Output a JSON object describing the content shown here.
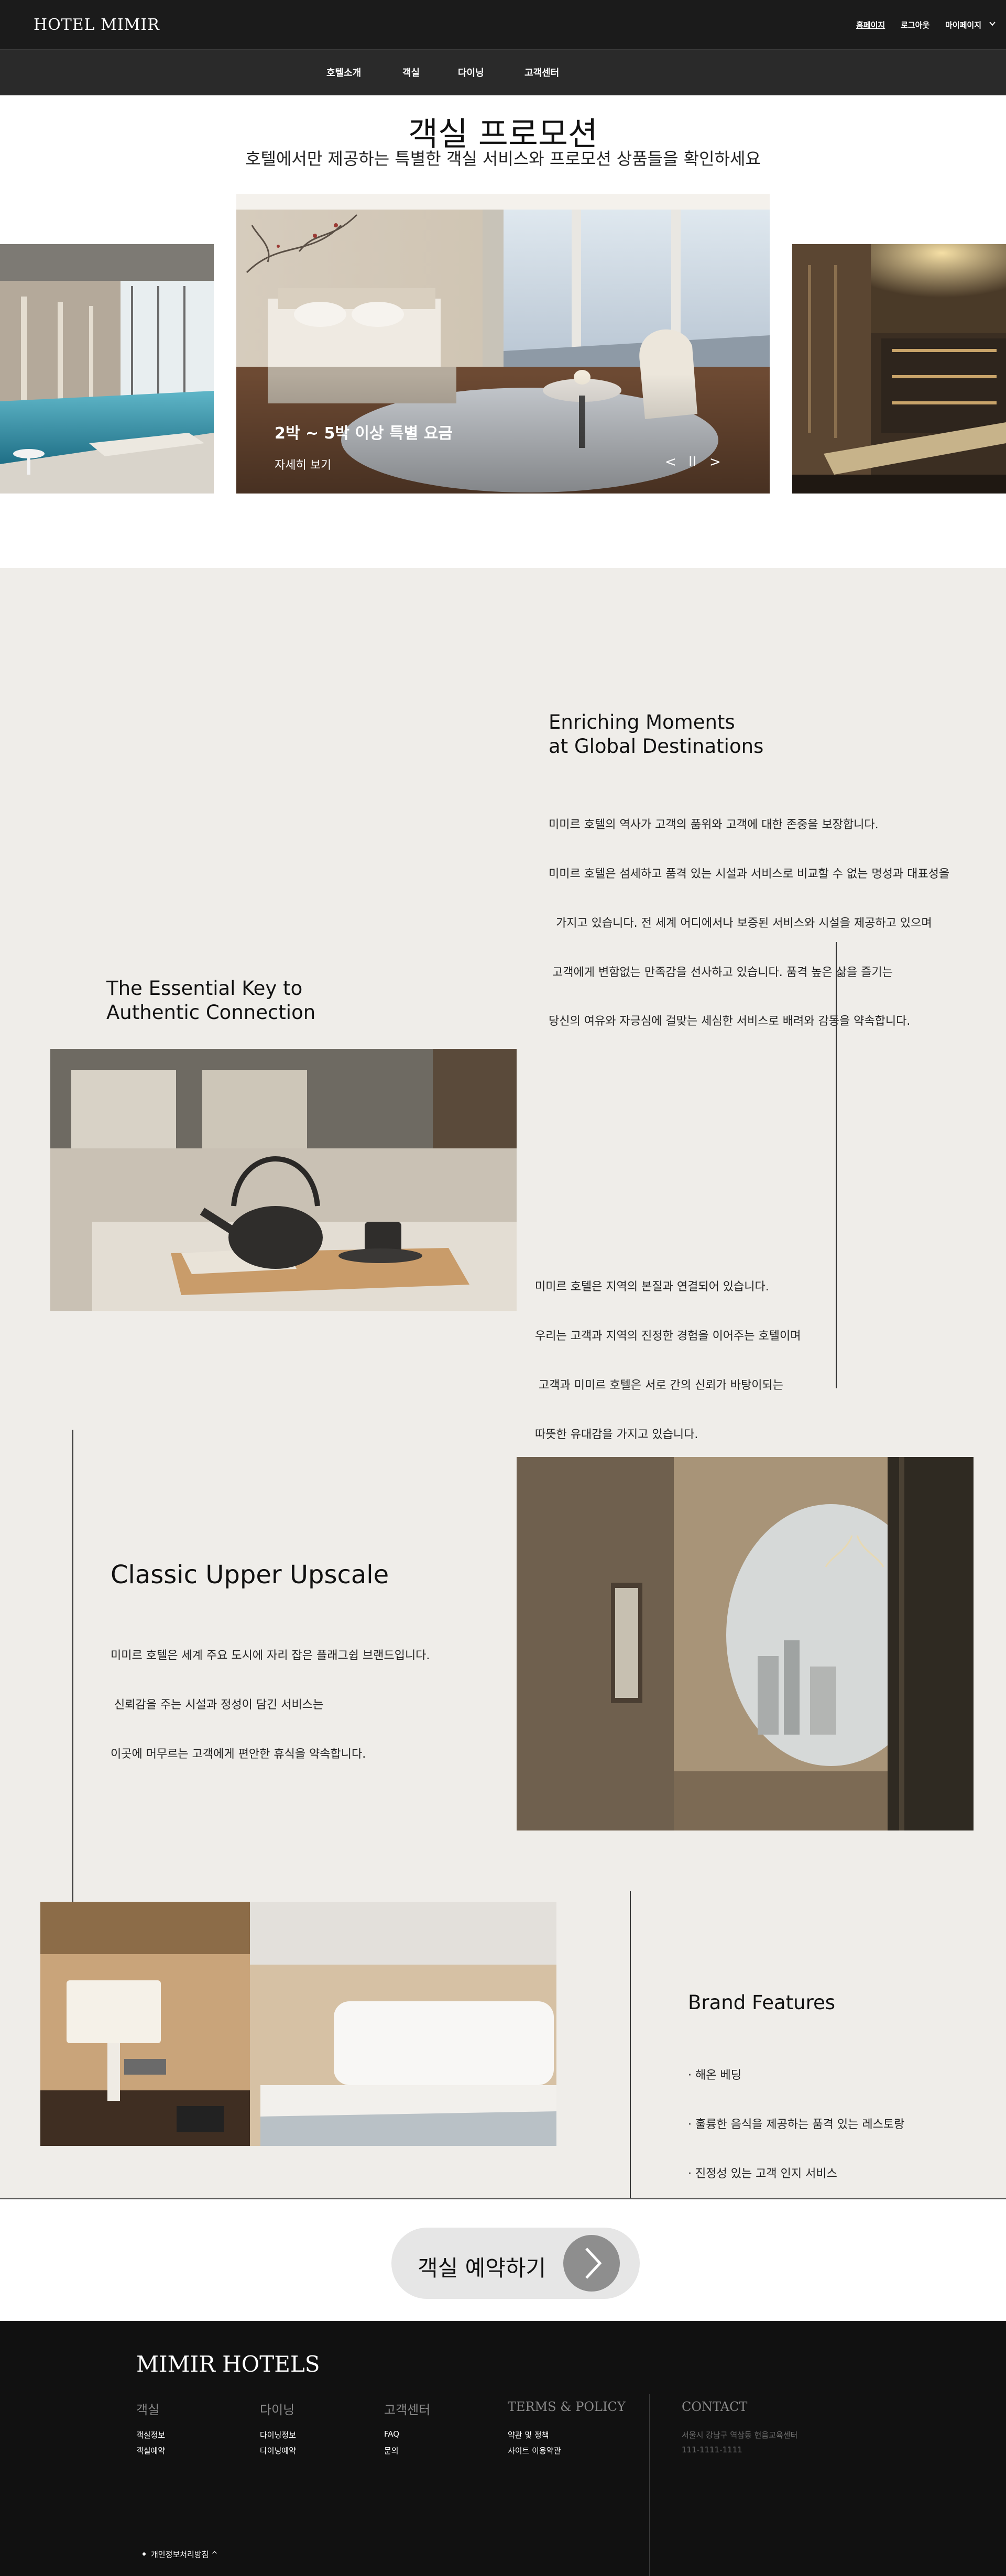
{
  "header": {
    "logo": "HOTEL MIMIR",
    "util": [
      "홈페이지",
      "로그아웃",
      "마이페이지"
    ],
    "nav": [
      "호텔소개",
      "객실",
      "다이닝",
      "고객센터"
    ]
  },
  "promo": {
    "title": "객실 프로모션",
    "subtitle": "호텔에서만 제공하는 특별한 객실 서비스와 프로모션 상품들을 확인하세요",
    "slide_caption": "2박 ~ 5박 이상 특별 요금",
    "slide_more": "자세히 보기",
    "slide_prev": "<",
    "slide_pause": "II",
    "slide_next": ">"
  },
  "about": {
    "s1_heading": [
      "Enriching Moments",
      "at Global Destinations"
    ],
    "s1_text": [
      "미미르 호텔의 역사가 고객의 품위와 고객에 대한 존중을 보장합니다.",
      "미미르 호텔은 섬세하고 품격 있는 시설과 서비스로 비교할 수 없는 명성과 대표성을",
      "  가지고 있습니다. 전 세계 어디에서나 보증된 서비스와 시설을 제공하고 있으며",
      " 고객에게 변함없는 만족감을 선사하고 있습니다. 품격 높은 삶을 즐기는",
      "당신의 여유와 자긍심에 걸맞는 세심한 서비스로 배려와 감동을 약속합니다."
    ],
    "s2_heading": [
      "The Essential Key to",
      "Authentic Connection"
    ],
    "s2_text": [
      "미미르 호텔은 지역의 본질과 연결되어 있습니다.",
      "우리는 고객과 지역의 진정한 경험을 이어주는 호텔이며",
      " 고객과 미미르 호텔은 서로 간의 신뢰가 바탕이되는",
      "따뜻한 유대감을 가지고 있습니다."
    ],
    "s3_heading": "Classic Upper Upscale",
    "s3_text": [
      "미미르 호텔은 세계 주요 도시에 자리 잡은 플래그쉽 브랜드입니다.",
      " 신뢰감을 주는 시설과 정성이 담긴 서비스는",
      "이곳에 머무르는 고객에게 편안한 휴식을 약속합니다."
    ],
    "s4_heading": "Brand Features",
    "s4_list": [
      "· 해온 베딩",
      "· 훌륭한 음식을 제공하는 품격 있는 레스토랑",
      "· 진정성 있는 고객 인지 서비스"
    ]
  },
  "reserve": {
    "label": "객실 예약하기",
    "arrow": ">"
  },
  "footer": {
    "logo": "MIMIR HOTELS",
    "cols": [
      {
        "head": "객실",
        "links": [
          "객실정보",
          "객실예약"
        ]
      },
      {
        "head": "다이닝",
        "links": [
          "다이닝정보",
          "다이닝예약"
        ]
      },
      {
        "head": "고객센터",
        "links": [
          "FAQ",
          "문의"
        ]
      },
      {
        "head": "TERMS & POLICY",
        "links": [
          "약관 및 정책",
          "사이트 이용약관"
        ]
      }
    ],
    "contact_head": "CONTACT",
    "contact_address": "서울시 강남구 역삼동 현음교육센터",
    "contact_phone": "111-1111-1111",
    "privacy": "개인정보처리방침 ^"
  }
}
